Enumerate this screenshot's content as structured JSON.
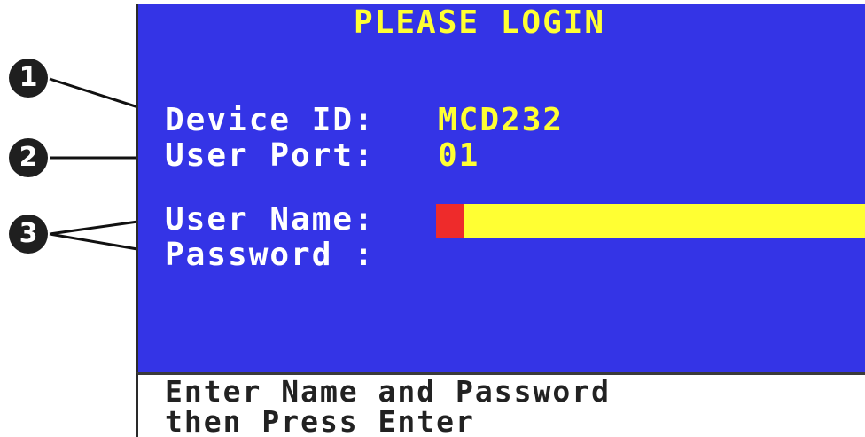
{
  "callouts": {
    "one": "1",
    "two": "2",
    "three": "3"
  },
  "login": {
    "title": "PLEASE LOGIN",
    "device_id_label": "Device ID:",
    "device_id_value": "MCD232",
    "user_port_label": "User Port:",
    "user_port_value": "01",
    "user_name_label": "User Name:",
    "password_label": "Password :",
    "user_name_value": "",
    "password_value": ""
  },
  "status": {
    "line1": "Enter Name and Password",
    "line2": "then Press Enter"
  },
  "colors": {
    "screen_background": "#3434e6",
    "label_text": "#ffffff",
    "value_text": "#ffff33",
    "input_field": "#ffff33",
    "cursor": "#ee2b2b",
    "status_text": "#222222"
  }
}
